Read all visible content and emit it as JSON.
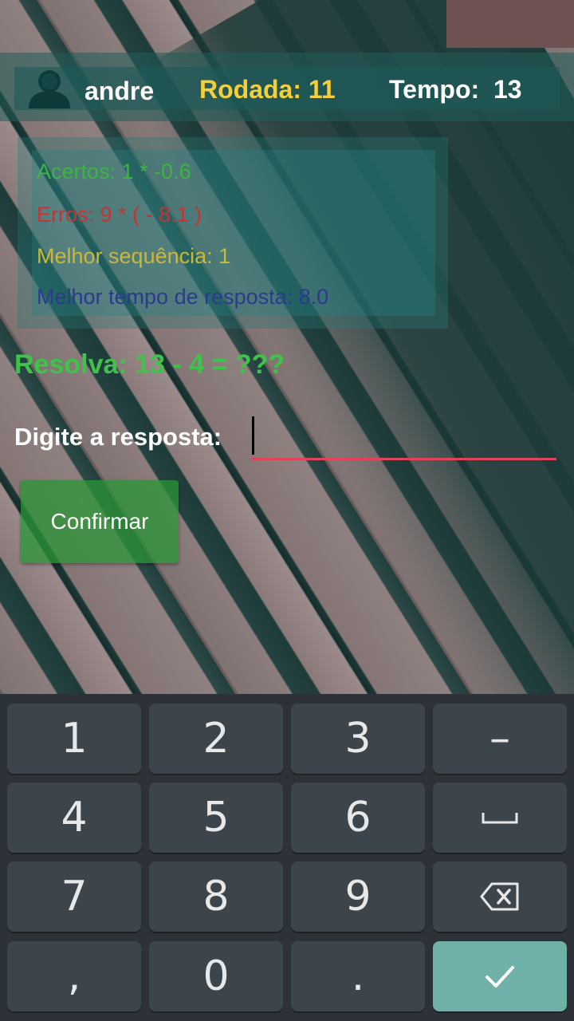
{
  "header": {
    "username": "andre",
    "round_label": "Rodada: 11",
    "time_label": "Tempo:  13"
  },
  "stats": {
    "hits": "Acertos: 1 * -0.6",
    "errors": "Erros: 9 * ( - 8.1 )",
    "best_streak": "Melhor sequência: 1",
    "best_response_time": "Melhor tempo de resposta: 8.0"
  },
  "problem": {
    "text": "Resolva: 13 - 4 = ???",
    "answer_label": "Digite a resposta:",
    "answer_value": ""
  },
  "confirm_button": {
    "label": "Confirmar"
  },
  "colors": {
    "hits": "#3fb33f",
    "errors": "#c53434",
    "streak": "#c9b83a",
    "best_time": "#2b3a8f",
    "round": "#f3d03b",
    "problem": "#3fc24a",
    "confirm": "#2b9635",
    "input_underline": "#e0435a",
    "keyboard_bg": "#2c3237",
    "key_bg": "#3d454c",
    "enter_key_bg": "#6fb0a8"
  },
  "keyboard": {
    "keys": [
      "1",
      "2",
      "3",
      "–",
      "4",
      "5",
      "6",
      "␣",
      "7",
      "8",
      "9",
      "⌫",
      ",",
      "0",
      ".",
      "✓"
    ],
    "icons": {
      "space": "space-icon",
      "backspace": "backspace-icon",
      "enter": "check-icon",
      "user": "user-icon"
    }
  }
}
